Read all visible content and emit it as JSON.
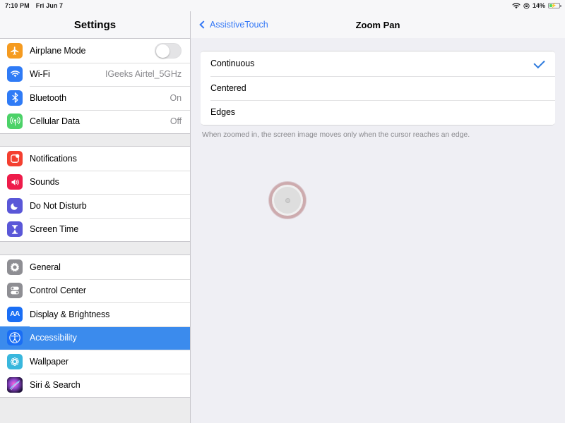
{
  "status_bar": {
    "time": "7:10 PM",
    "date": "Fri Jun 7",
    "wifi_icon": "wifi-icon",
    "secondary_icon": "rotation-lock-icon",
    "battery_percent": "14%",
    "battery_level": 14,
    "battery_charging": true,
    "battery_color": "#4cd964"
  },
  "sidebar": {
    "title": "Settings",
    "selected_item": "Accessibility",
    "highlight_color": "#3b8bed",
    "groups": [
      {
        "items": [
          {
            "label": "Airplane Mode",
            "icon": "airplane-icon",
            "icon_color": "#f59b20",
            "control": "toggle",
            "toggle_on": false
          },
          {
            "label": "Wi-Fi",
            "icon": "wifi-icon",
            "icon_color": "#2f7bf6",
            "value": "IGeeks Airtel_5GHz"
          },
          {
            "label": "Bluetooth",
            "icon": "bluetooth-icon",
            "icon_color": "#2f7bf6",
            "value": "On"
          },
          {
            "label": "Cellular Data",
            "icon": "cellular-antenna-icon",
            "icon_color": "#4cd268",
            "value": "Off"
          }
        ]
      },
      {
        "items": [
          {
            "label": "Notifications",
            "icon": "notifications-icon",
            "icon_color": "#f43f30"
          },
          {
            "label": "Sounds",
            "icon": "speaker-icon",
            "icon_color": "#ee1c4a"
          },
          {
            "label": "Do Not Disturb",
            "icon": "moon-icon",
            "icon_color": "#5a57d8"
          },
          {
            "label": "Screen Time",
            "icon": "hourglass-icon",
            "icon_color": "#5a57d8"
          }
        ]
      },
      {
        "items": [
          {
            "label": "General",
            "icon": "gear-icon",
            "icon_color": "#8e8e93"
          },
          {
            "label": "Control Center",
            "icon": "sliders-icon",
            "icon_color": "#8e8e93"
          },
          {
            "label": "Display & Brightness",
            "icon": "text-size-icon",
            "icon_color": "#1a6ef5",
            "glyph": "AA"
          },
          {
            "label": "Accessibility",
            "icon": "accessibility-icon",
            "icon_color": "#1a6ef5",
            "selected": true
          },
          {
            "label": "Wallpaper",
            "icon": "wallpaper-flower-icon",
            "icon_color": "#39b7dd"
          },
          {
            "label": "Siri & Search",
            "icon": "siri-icon",
            "icon_color": "#2b1a4a"
          }
        ]
      }
    ]
  },
  "main": {
    "back_label": "AssistiveTouch",
    "title": "Zoom Pan",
    "options": [
      {
        "label": "Continuous",
        "checked": true
      },
      {
        "label": "Centered",
        "checked": false
      },
      {
        "label": "Edges",
        "checked": false
      }
    ],
    "footnote": "When zoomed in, the screen image moves only when the cursor reaches an edge.",
    "assistive_touch_cursor": {
      "name": "assistive-touch-cursor",
      "ring_color": "#c38c91",
      "fill_color": "#dedede"
    }
  }
}
